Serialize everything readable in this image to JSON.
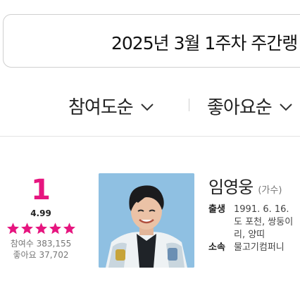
{
  "week_selector": {
    "text": "2025년 3월 1주차 주간랭"
  },
  "sort": {
    "option1": "참여도순",
    "option2": "좋아요순"
  },
  "entry": {
    "rank": "1",
    "rating": "4.99",
    "stars": 5,
    "participation_label": "참여수",
    "participation_value": "383,155",
    "likes_label": "좋아요",
    "likes_value": "37,702",
    "name": "임영웅",
    "job": "(가수)",
    "birth_label": "출생",
    "birth_line1": "1991. 6. 16.",
    "birth_line2": "도 포천, 쌍둥이",
    "birth_line3": "리, 양띠",
    "agency_label": "소속",
    "agency_value": "물고기컴퍼니"
  },
  "colors": {
    "accent": "#e6157f",
    "photo_bg": "#8fc0e2"
  }
}
